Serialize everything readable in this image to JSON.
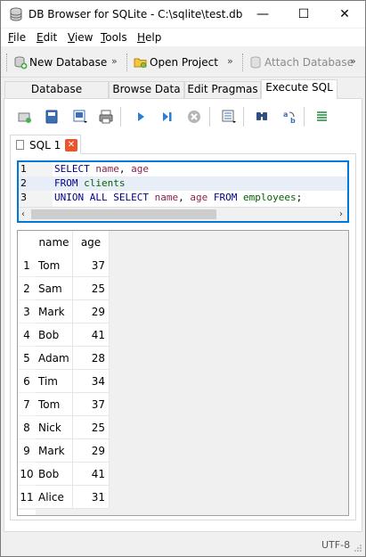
{
  "window": {
    "title": "DB Browser for SQLite - C:\\sqlite\\test.db",
    "controls": {
      "minimize": "—",
      "maximize": "☐",
      "close": "✕"
    }
  },
  "menu": [
    {
      "label": "File",
      "key": "F",
      "rest": "ile"
    },
    {
      "label": "Edit",
      "key": "E",
      "rest": "dit"
    },
    {
      "label": "View",
      "key": "V",
      "rest": "iew"
    },
    {
      "label": "Tools",
      "key": "T",
      "rest": "ools"
    },
    {
      "label": "Help",
      "key": "H",
      "rest": "elp"
    }
  ],
  "toolbar": {
    "new_database": "New Database",
    "open_project": "Open Project",
    "attach_database": "Attach Database",
    "more": "»"
  },
  "tabs": [
    "Database Structure",
    "Browse Data",
    "Edit Pragmas",
    "Execute SQL"
  ],
  "active_tab": "Execute SQL",
  "sql_tab": {
    "label": "SQL 1",
    "close": "✕"
  },
  "editor": {
    "lines": [
      {
        "n": "1",
        "tokens": [
          {
            "t": "SELECT",
            "c": "kw"
          },
          {
            "t": " ",
            "c": "plain"
          },
          {
            "t": "name",
            "c": "id"
          },
          {
            "t": ", ",
            "c": "plain"
          },
          {
            "t": "age",
            "c": "id"
          }
        ]
      },
      {
        "n": "2",
        "tokens": [
          {
            "t": "FROM",
            "c": "kw"
          },
          {
            "t": " ",
            "c": "plain"
          },
          {
            "t": "clients",
            "c": "tbl"
          }
        ]
      },
      {
        "n": "3",
        "tokens": [
          {
            "t": "UNION ALL SELECT",
            "c": "kw"
          },
          {
            "t": " ",
            "c": "plain"
          },
          {
            "t": "name",
            "c": "id"
          },
          {
            "t": ", ",
            "c": "plain"
          },
          {
            "t": "age",
            "c": "id"
          },
          {
            "t": " ",
            "c": "plain"
          },
          {
            "t": "FROM",
            "c": "kw"
          },
          {
            "t": " ",
            "c": "plain"
          },
          {
            "t": "employees",
            "c": "tbl"
          },
          {
            "t": ";",
            "c": "plain"
          }
        ]
      }
    ],
    "scroll_left": "‹",
    "scroll_right": "›"
  },
  "results": {
    "columns": [
      "name",
      "age"
    ],
    "rows": [
      {
        "n": "1",
        "name": "Tom",
        "age": "37"
      },
      {
        "n": "2",
        "name": "Sam",
        "age": "25"
      },
      {
        "n": "3",
        "name": "Mark",
        "age": "29"
      },
      {
        "n": "4",
        "name": "Bob",
        "age": "41"
      },
      {
        "n": "5",
        "name": "Adam",
        "age": "28"
      },
      {
        "n": "6",
        "name": "Tim",
        "age": "34"
      },
      {
        "n": "7",
        "name": "Tom",
        "age": "37"
      },
      {
        "n": "8",
        "name": "Nick",
        "age": "25"
      },
      {
        "n": "9",
        "name": "Mark",
        "age": "29"
      },
      {
        "n": "10",
        "name": "Bob",
        "age": "41"
      },
      {
        "n": "11",
        "name": "Alice",
        "age": "31"
      }
    ]
  },
  "status": {
    "encoding": "UTF-8"
  },
  "colors": {
    "accent": "#0078d7",
    "close_tab": "#e8542b",
    "keyword": "#00008b",
    "identifier": "#8b2252",
    "table": "#006400"
  }
}
